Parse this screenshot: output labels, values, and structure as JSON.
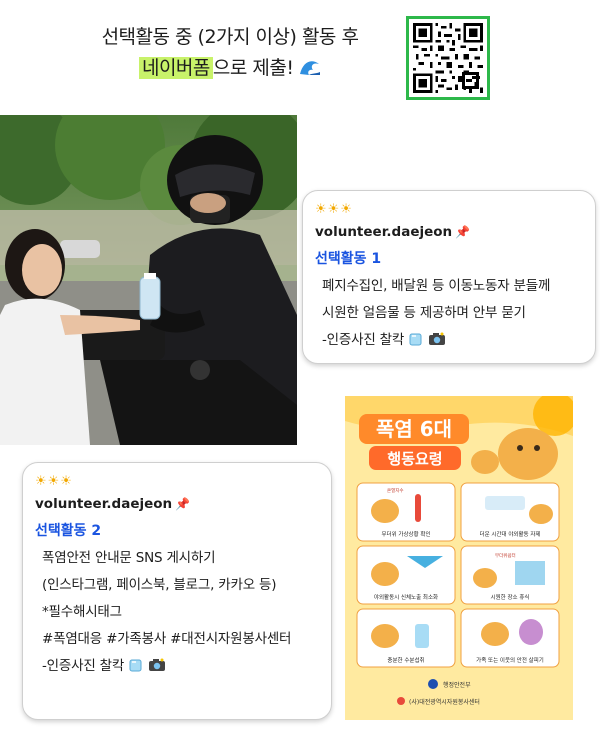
{
  "header": {
    "line1": "선택활동 중 (2가지 이상) 활동 후",
    "highlight": "네이버폼",
    "line2_rest": "으로 제출!",
    "wave_icon": "water-wave-icon"
  },
  "qr": {
    "icon": "qr-code-icon",
    "border_color": "#2db84a"
  },
  "card1": {
    "suns": "☀☀☀",
    "username": "volunteer.daejeon",
    "pin": "📌",
    "activity_title": "선택활동 1",
    "lines": [
      "폐지수집인, 배달원 등 이동노동자 분들께",
      "시원한 얼음물 등 제공하며 안부 묻기",
      "-인증사진 찰칵"
    ]
  },
  "card2": {
    "suns": "☀☀☀",
    "username": "volunteer.daejeon",
    "pin": "📌",
    "activity_title": "선택활동 2",
    "lines": [
      "폭염안전 안내문 SNS 게시하기",
      "(인스타그램, 페이스북, 블로그, 카카오 등)",
      "*필수해시태그",
      "#폭염대응 #가족봉사 #대전시자원봉사센터",
      "-인증사진 찰칵"
    ]
  },
  "poster": {
    "title": "폭염 6대",
    "subtitle": "행동요령",
    "panels": [
      {
        "caption": "무더위 가상상황 확인",
        "tag": "온열지수"
      },
      {
        "caption": "더운 시간대 야외활동 자제",
        "tag": ""
      },
      {
        "caption": "야외활동시 신체노출 최소화",
        "tag": ""
      },
      {
        "caption": "시원한 장소 휴식",
        "tag": "무더위쉼터"
      },
      {
        "caption": "충분한 수분섭취",
        "tag": ""
      },
      {
        "caption": "가족 또는 이웃의 안전 살피기",
        "tag": ""
      }
    ],
    "footer1": "행정안전부",
    "footer2": "(사)대전광역시자원봉사센터"
  },
  "colors": {
    "accent_blue": "#1a54e0",
    "highlight_green": "#c8f26a",
    "sun": "#f2a800",
    "poster_bg": "#ffe9a8"
  }
}
